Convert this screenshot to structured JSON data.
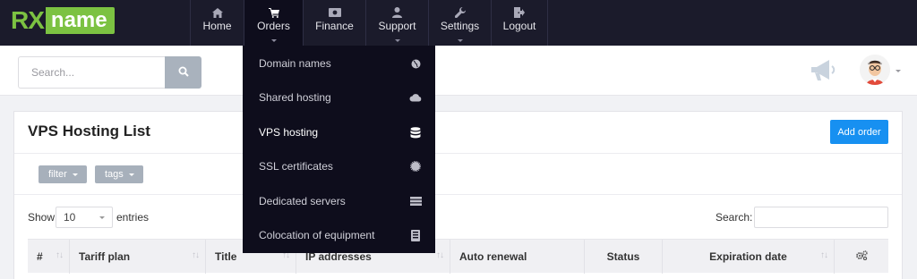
{
  "brand": {
    "logo_part1": "RX",
    "logo_part2": "name"
  },
  "nav": {
    "items": [
      {
        "label": "Home",
        "icon": "home-icon"
      },
      {
        "label": "Orders",
        "icon": "cart-icon",
        "active": true
      },
      {
        "label": "Finance",
        "icon": "money-icon"
      },
      {
        "label": "Support",
        "icon": "user-icon"
      },
      {
        "label": "Settings",
        "icon": "wrench-icon"
      },
      {
        "label": "Logout",
        "icon": "logout-icon"
      }
    ]
  },
  "orders_menu": {
    "items": [
      {
        "label": "Domain names",
        "icon": "globe-icon"
      },
      {
        "label": "Shared hosting",
        "icon": "cloud-icon"
      },
      {
        "label": "VPS hosting",
        "icon": "database-icon",
        "active": true
      },
      {
        "label": "SSL certificates",
        "icon": "certificate-icon"
      },
      {
        "label": "Dedicated servers",
        "icon": "server-icon"
      },
      {
        "label": "Colocation of equipment",
        "icon": "rack-icon"
      }
    ]
  },
  "search": {
    "placeholder": "Search..."
  },
  "panel": {
    "title": "VPS Hosting List",
    "add_order_label": "Add order",
    "filter_label": "filter",
    "tags_label": "tags",
    "show_label": "Show",
    "page_size": "10",
    "entries_label": "entries",
    "search_label": "Search:"
  },
  "table": {
    "columns": [
      "#",
      "Tariff plan",
      "Title",
      "IP addresses",
      "Auto renewal",
      "Status",
      "Expiration date"
    ]
  },
  "colors": {
    "topbar": "#1b1b2b",
    "dropdown": "#0e0d1c",
    "brand_green": "#7cc242",
    "accent_blue": "#1790f1",
    "chip_gray": "#a7b0bb"
  }
}
